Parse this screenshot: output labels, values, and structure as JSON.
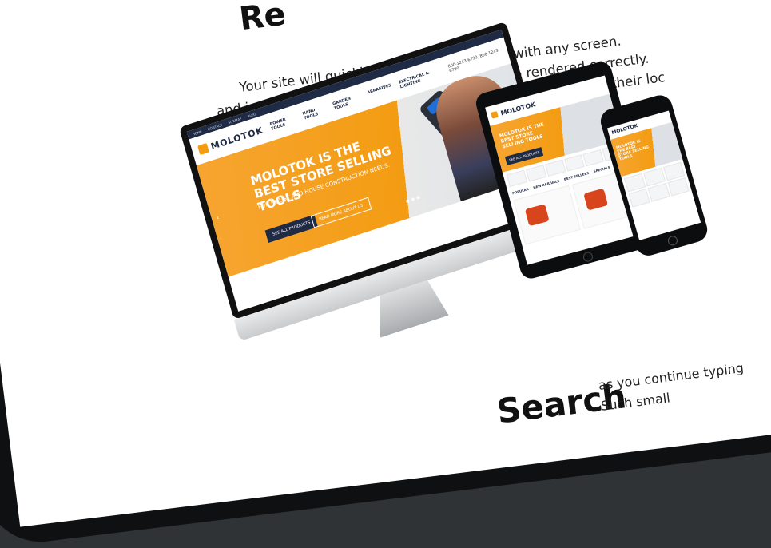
{
  "top_heading": "Re",
  "paragraph_lines": [
    "Your site will quickly adapt to any gadget with any screen.",
    "and images are flexible as well, so they will be rendered correctly.",
    "as your visitors will not be restricted by any limits in terms of their loc"
  ],
  "bottom_heading": "Search",
  "bottom_paragraph_lines": [
    "as you continue typing",
    "Such small"
  ],
  "site": {
    "topbar_links": [
      "HOME",
      "CONTACT",
      "SITEMAP",
      "BLOG"
    ],
    "logo": "MOLOTOK",
    "nav": [
      "POWER TOOLS",
      "HAND TOOLS",
      "GARDEN TOOLS",
      "ABRASIVES",
      "ELECTRICAL & LIGHTING"
    ],
    "phones": "800-1243-6790, 800-1243-6790",
    "hero_title": "MOLOTOK IS THE BEST STORE SELLING TOOLS",
    "hero_subtitle": "FOR HOUSE AND HOUSE CONSTRUCTION NEEDS.",
    "hero_button_primary": "SEE ALL PRODUCTS",
    "hero_button_secondary": "READ MORE ABOUT US",
    "tablet_tabs": [
      "POPULAR",
      "NEW ARRIVALS",
      "BEST SELLERS",
      "SPECIALS"
    ],
    "tablet_button": "SEE ALL PRODUCTS"
  },
  "colors": {
    "accent": "#f39c12",
    "navy": "#1f2a44",
    "background": "#2f3336"
  }
}
